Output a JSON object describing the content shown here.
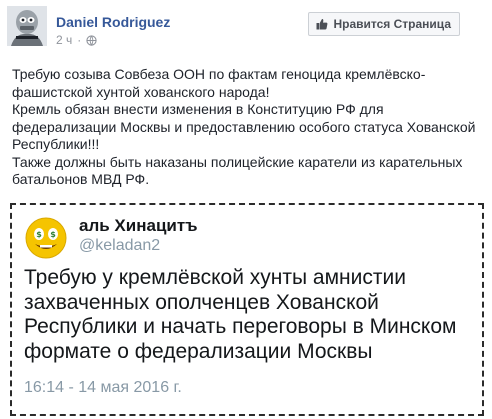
{
  "post": {
    "author": "Daniel Rodriguez",
    "time": "2 ч",
    "privacy_separator": "·",
    "like_page_label": "Нравится Страница",
    "text_lines": [
      "Требую созыва Совбеза ООН по фактам геноцида кремлёвско-фашистской хунтой хованского народа!",
      "Кремль обязан внести изменения в Конституцию РФ для федерализации Москвы и предоставлению особого статуса Хованской Республики!!!",
      "Также должны быть наказаны полицейские каратели из карательных батальонов МВД РФ."
    ]
  },
  "embedded_tweet": {
    "name": "аль Хинацитъ",
    "handle": "@keladan2",
    "text": "Требую у кремлёвской хунты амнистии захваченных ополченцев Хованской Республики и начать переговоры в Минском формате о федерализации Москвы",
    "date": "16:14 - 14 мая 2016 г."
  },
  "icons": {
    "privacy": "globe-icon",
    "like": "thumbs-up-icon"
  },
  "colors": {
    "author_link": "#365899",
    "meta_gray": "#90949c",
    "tweet_gray": "#8899a6",
    "emoji_yellow": "#f5c400"
  }
}
